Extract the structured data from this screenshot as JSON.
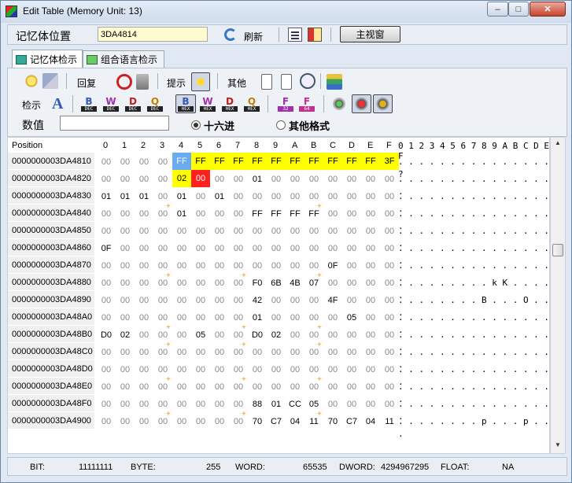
{
  "window": {
    "title": "Edit Table (Memory Unit: 13)",
    "minimize": "–",
    "maximize": "□",
    "close": "✕"
  },
  "address_bar": {
    "label": "记忆体位置",
    "value": "3DA4814",
    "refresh_label": "刷新",
    "main_view_label": "主视窗"
  },
  "tabs": [
    {
      "label": "记忆体检示"
    },
    {
      "label": "组合语言检示"
    }
  ],
  "toolbar": {
    "restore_label": "回复",
    "hint_label": "提示",
    "other_label": "其他",
    "view_label": "检示",
    "value_label": "数值",
    "hex_label": "十六进",
    "other_format_label": "其他格式",
    "hex_tags": [
      "DEC",
      "DEC",
      "DEC",
      "DEC",
      "HEX",
      "HEX",
      "HEX",
      "HEX"
    ],
    "hex_letters": [
      "B",
      "W",
      "D",
      "Q",
      "B",
      "W",
      "D",
      "Q"
    ],
    "float_labels": [
      "32",
      "64"
    ]
  },
  "grid": {
    "position_header": "Position",
    "col_headers": [
      "0",
      "1",
      "2",
      "3",
      "4",
      "5",
      "6",
      "7",
      "8",
      "9",
      "A",
      "B",
      "C",
      "D",
      "E",
      "F"
    ],
    "ascii_header": "0 1 2 3 4 5 6 7 8 9 A B C D E F",
    "rows": [
      {
        "addr": "0000000003DA4810",
        "bytes": [
          "00",
          "00",
          "00",
          "00",
          "FF",
          "FF",
          "FF",
          "FF",
          "FF",
          "FF",
          "FF",
          "FF",
          "FF",
          "FF",
          "FF",
          "3F"
        ],
        "ascii": ". . . . . . . . . . . . . . . ?"
      },
      {
        "addr": "0000000003DA4820",
        "bytes": [
          "00",
          "00",
          "00",
          "00",
          "02",
          "00",
          "00",
          "00",
          "01",
          "00",
          "00",
          "00",
          "00",
          "00",
          "00",
          "00"
        ],
        "ascii": ". . . . . . . . . . . . . . . ."
      },
      {
        "addr": "0000000003DA4830",
        "bytes": [
          "01",
          "01",
          "01",
          "00",
          "01",
          "00",
          "01",
          "00",
          "00",
          "00",
          "00",
          "00",
          "00",
          "00",
          "00",
          "00"
        ],
        "ascii": ". . . . . . . . . . . . . . . ."
      },
      {
        "addr": "0000000003DA4840",
        "bytes": [
          "00",
          "00",
          "00",
          "00",
          "01",
          "00",
          "00",
          "00",
          "FF",
          "FF",
          "FF",
          "FF",
          "00",
          "00",
          "00",
          "00"
        ],
        "ascii": ". . . . . . . . . . . . . . . ."
      },
      {
        "addr": "0000000003DA4850",
        "bytes": [
          "00",
          "00",
          "00",
          "00",
          "00",
          "00",
          "00",
          "00",
          "00",
          "00",
          "00",
          "00",
          "00",
          "00",
          "00",
          "00"
        ],
        "ascii": ". . . . . . . . . . . . . . . ."
      },
      {
        "addr": "0000000003DA4860",
        "bytes": [
          "0F",
          "00",
          "00",
          "00",
          "00",
          "00",
          "00",
          "00",
          "00",
          "00",
          "00",
          "00",
          "00",
          "00",
          "00",
          "00"
        ],
        "ascii": ". . . . . . . . . . . . . . . ."
      },
      {
        "addr": "0000000003DA4870",
        "bytes": [
          "00",
          "00",
          "00",
          "00",
          "00",
          "00",
          "00",
          "00",
          "00",
          "00",
          "00",
          "00",
          "0F",
          "00",
          "00",
          "00"
        ],
        "ascii": ". . . . . . . . . . . . . . . ."
      },
      {
        "addr": "0000000003DA4880",
        "bytes": [
          "00",
          "00",
          "00",
          "00",
          "00",
          "00",
          "00",
          "00",
          "F0",
          "6B",
          "4B",
          "07",
          "00",
          "00",
          "00",
          "00"
        ],
        "ascii": ". . . . . . . . . k K . . . . ."
      },
      {
        "addr": "0000000003DA4890",
        "bytes": [
          "00",
          "00",
          "00",
          "00",
          "00",
          "00",
          "00",
          "00",
          "42",
          "00",
          "00",
          "00",
          "4F",
          "00",
          "00",
          "00"
        ],
        "ascii": ". . . . . . . . B . . . O . . ."
      },
      {
        "addr": "0000000003DA48A0",
        "bytes": [
          "00",
          "00",
          "00",
          "00",
          "00",
          "00",
          "00",
          "00",
          "01",
          "00",
          "00",
          "00",
          "00",
          "05",
          "00",
          "00"
        ],
        "ascii": ". . . . . . . . . . . . . . . ."
      },
      {
        "addr": "0000000003DA48B0",
        "bytes": [
          "D0",
          "02",
          "00",
          "00",
          "00",
          "05",
          "00",
          "00",
          "D0",
          "02",
          "00",
          "00",
          "00",
          "00",
          "00",
          "00"
        ],
        "ascii": ". . . . . . . . . . . . . . . ."
      },
      {
        "addr": "0000000003DA48C0",
        "bytes": [
          "00",
          "00",
          "00",
          "00",
          "00",
          "00",
          "00",
          "00",
          "00",
          "00",
          "00",
          "00",
          "00",
          "00",
          "00",
          "00"
        ],
        "ascii": ". . . . . . . . . . . . . . . ."
      },
      {
        "addr": "0000000003DA48D0",
        "bytes": [
          "00",
          "00",
          "00",
          "00",
          "00",
          "00",
          "00",
          "00",
          "00",
          "00",
          "00",
          "00",
          "00",
          "00",
          "00",
          "00"
        ],
        "ascii": ". . . . . . . . . . . . . . . ."
      },
      {
        "addr": "0000000003DA48E0",
        "bytes": [
          "00",
          "00",
          "00",
          "00",
          "00",
          "00",
          "00",
          "00",
          "00",
          "00",
          "00",
          "00",
          "00",
          "00",
          "00",
          "00"
        ],
        "ascii": ". . . . . . . . . . . . . . . ."
      },
      {
        "addr": "0000000003DA48F0",
        "bytes": [
          "00",
          "00",
          "00",
          "00",
          "00",
          "00",
          "00",
          "00",
          "88",
          "01",
          "CC",
          "05",
          "00",
          "00",
          "00",
          "00"
        ],
        "ascii": ". . . . . . . . . . . . . . . ."
      },
      {
        "addr": "0000000003DA4900",
        "bytes": [
          "00",
          "00",
          "00",
          "00",
          "00",
          "00",
          "00",
          "00",
          "70",
          "C7",
          "04",
          "11",
          "70",
          "C7",
          "04",
          "11"
        ],
        "ascii": ". . . . . . . . p . . . p . . ."
      }
    ]
  },
  "status": {
    "bit_label": "BIT:",
    "bit_value": "11111111",
    "byte_label": "BYTE:",
    "byte_value": "255",
    "word_label": "WORD:",
    "word_value": "65535",
    "dword_label": "DWORD:",
    "dword_value": "4294967295",
    "float_label": "FLOAT:",
    "float_value": "NA"
  },
  "colors": {
    "highlight_yellow": "#ffff00",
    "selected_blue": "#6aaaf0",
    "changed_red": "#ff2020",
    "marker_orange": "#e79b16"
  }
}
